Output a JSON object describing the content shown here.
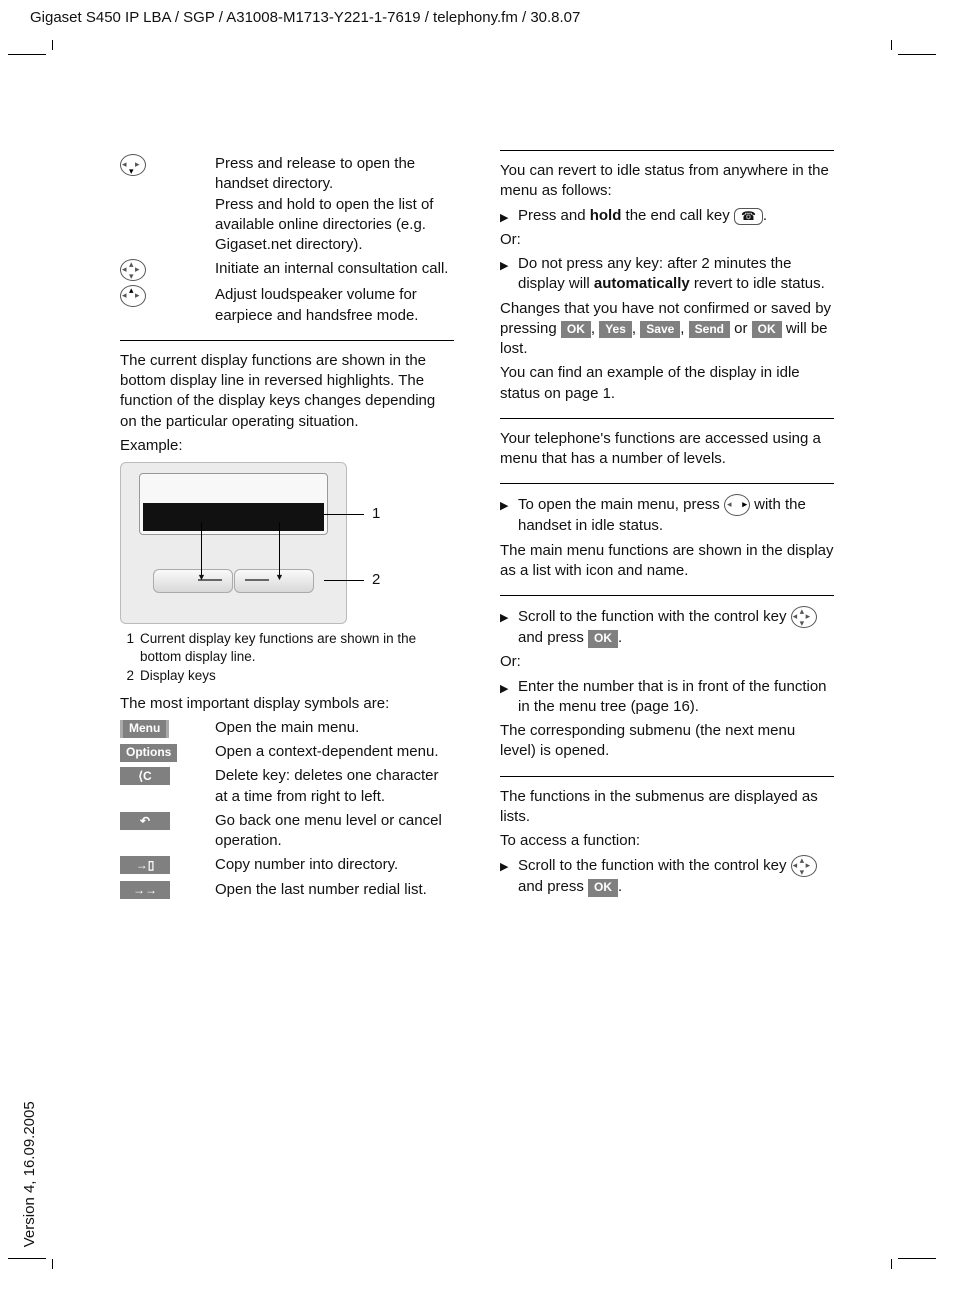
{
  "header": "Gigaset S450 IP LBA / SGP / A31008-M1713-Y221-1-7619 / telephony.fm / 30.8.07",
  "version": "Version 4, 16.09.2005",
  "left": {
    "nav_items": [
      {
        "icon": "down",
        "text": "Press and release to open the handset directory.\nPress and hold to open the list of available online directories (e.g. Gigaset.net directory)."
      },
      {
        "icon": "both",
        "text": "Initiate an internal consultation call."
      },
      {
        "icon": "up",
        "text": "Adjust loudspeaker volume for earpiece and handsfree mode."
      }
    ],
    "para1": "The current display functions are shown in the bottom display line in reversed highlights. The function of the display keys changes depending on the particular operating situation.",
    "example_label": "Example:",
    "diagram_labels": {
      "one": "1",
      "two": "2"
    },
    "captions": [
      {
        "n": "1",
        "text": "Current display key functions are shown in the bottom display line."
      },
      {
        "n": "2",
        "text": "Display keys"
      }
    ],
    "para2": "The most important display symbols are:",
    "symbols": [
      {
        "key": "Menu",
        "type": "menu",
        "desc": "Open the main menu."
      },
      {
        "key": "Options",
        "type": "chip",
        "desc": "Open a context-dependent menu."
      },
      {
        "key": "⟨C",
        "type": "glyph",
        "desc": "Delete key: deletes one character at a time from right to left."
      },
      {
        "key": "↶",
        "type": "glyph",
        "desc": "Go back one menu level or cancel operation."
      },
      {
        "key": "→▯",
        "type": "glyph",
        "desc": "Copy number into directory."
      },
      {
        "key": "→→",
        "type": "glyph",
        "desc": "Open the last number redial list."
      }
    ]
  },
  "right": {
    "para1": "You can revert to idle status from anywhere in the menu as follows:",
    "b1_pre": "Press and ",
    "b1_bold": "hold",
    "b1_post": " the end call key ",
    "or": "Or:",
    "b2_pre": "Do not press any key: after 2 minutes the display will ",
    "b2_bold": "automatically",
    "b2_post": " revert to idle status.",
    "para2_pre": "Changes that you have not confirmed or saved by pressing ",
    "chips": [
      "OK",
      "Yes",
      "Save",
      "Send"
    ],
    "para2_mid": " or ",
    "chip_last": "OK",
    "para2_post": " will be lost.",
    "para3": "You can find an example of the display in idle status on page 1.",
    "para4": "Your telephone's functions are accessed using a menu that has a number of levels.",
    "mm_b1_pre": "To open the main menu, press ",
    "mm_b1_post": " with the handset in idle status.",
    "para5": "The main menu functions are shown in the display as a list with icon and name.",
    "sm_b1_pre": "Scroll to the function with the control key ",
    "sm_b1_mid": " and press ",
    "sm_b2": "Enter the number that is in front of the function in the menu tree (page 16).",
    "para6": "The corresponding submenu (the next menu level) is opened.",
    "para7": "The functions in the submenus are displayed as lists.",
    "para8": "To access a function:",
    "fn_b1_pre": "Scroll to the function with the control key ",
    "fn_b1_mid": " and press "
  }
}
